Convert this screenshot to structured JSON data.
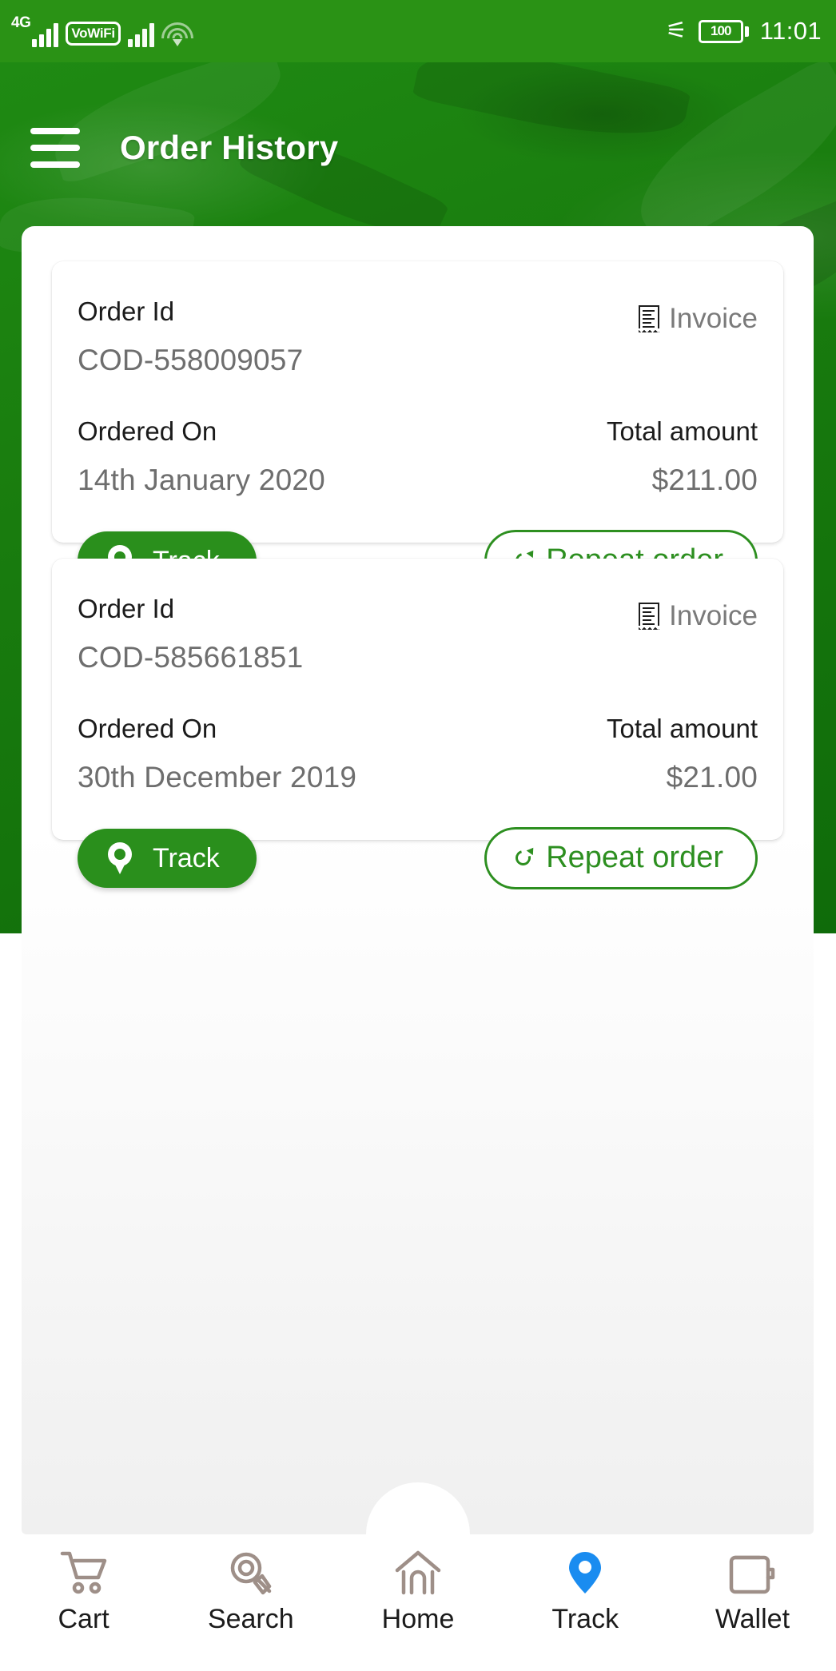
{
  "status_bar": {
    "network_label": "4G",
    "vowifi_label": "VoWiFi",
    "wifi_icon": "wifi-icon",
    "bluetooth_icon": "bluetooth-icon",
    "battery_level": "100",
    "time": "11:01"
  },
  "header": {
    "menu_icon": "hamburger-menu-icon",
    "title": "Order History",
    "background_color": "#197c0e",
    "accent_color": "#2a8f1c"
  },
  "orders": [
    {
      "order_id_label": "Order Id",
      "order_id": "COD-558009057",
      "invoice_label": "Invoice",
      "invoice_icon": "receipt-icon",
      "ordered_on_label": "Ordered On",
      "ordered_on": "14th January 2020",
      "total_label": "Total amount",
      "total": "$211.00",
      "track_label": "Track",
      "track_icon": "location-pin-icon",
      "repeat_label": "Repeat order",
      "repeat_icon": "refresh-arrow-icon"
    },
    {
      "order_id_label": "Order Id",
      "order_id": "COD-585661851",
      "invoice_label": "Invoice",
      "invoice_icon": "receipt-icon",
      "ordered_on_label": "Ordered On",
      "ordered_on": "30th December 2019",
      "total_label": "Total amount",
      "total": "$21.00",
      "track_label": "Track",
      "track_icon": "location-pin-icon",
      "repeat_label": "Repeat order",
      "repeat_icon": "refresh-arrow-icon"
    }
  ],
  "bottom_nav": {
    "active_color": "#1a8cf0",
    "inactive_color": "#9e8f88",
    "items": [
      {
        "label": "Cart",
        "icon": "shopping-cart-icon",
        "active": false
      },
      {
        "label": "Search",
        "icon": "magnifier-icon",
        "active": false
      },
      {
        "label": "Home",
        "icon": "home-icon",
        "active": false
      },
      {
        "label": "Track",
        "icon": "location-pin-icon",
        "active": true
      },
      {
        "label": "Wallet",
        "icon": "wallet-icon",
        "active": false
      }
    ]
  }
}
